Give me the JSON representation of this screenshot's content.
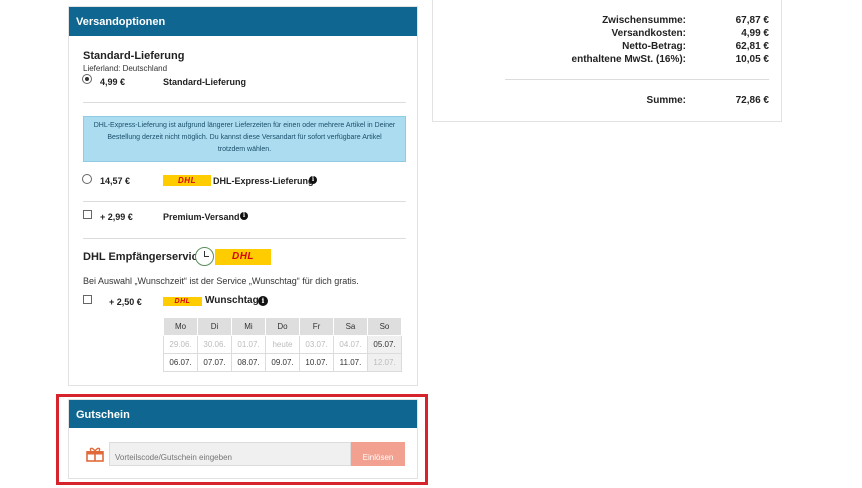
{
  "shipping": {
    "title": "Versandoptionen",
    "standard": {
      "heading": "Standard-Lieferung",
      "country": "Lieferland: Deutschland",
      "price": "4,99 €",
      "label": "Standard-Lieferung",
      "selected": true
    },
    "notice": [
      "DHL-Express-Lieferung ist aufgrund längerer Lieferzeiten für einen oder mehrere Artikel in Deiner",
      "Bestellung derzeit nicht möglich. Du kannst diese Versandart für sofort verfügbare Artikel",
      "trotzdem wählen."
    ],
    "express": {
      "price": "14,57 €",
      "logo": "DHL",
      "label": "DHL-Express-Lieferung"
    },
    "premium": {
      "price": "+ 2,99 €",
      "label": "Premium-Versand"
    },
    "services": {
      "heading": "DHL Empfängerservices",
      "logo": "DHL",
      "note": "Bei Auswahl „Wunschzeit“ ist der Service „Wunschtag“ für dich gratis.",
      "wunschtag": {
        "price": "+ 2,50 €",
        "logo": "DHL",
        "label": "Wunschtag"
      }
    },
    "calendar": {
      "days": [
        "Mo",
        "Di",
        "Mi",
        "Do",
        "Fr",
        "Sa",
        "So"
      ],
      "rows": [
        [
          "29.06.",
          "30.06.",
          "01.07.",
          "heute",
          "03.07.",
          "04.07.",
          "05.07."
        ],
        [
          "06.07.",
          "07.07.",
          "08.07.",
          "09.07.",
          "10.07.",
          "11.07.",
          "12.07."
        ]
      ]
    },
    "icons": {
      "info": "info-icon",
      "clock": "clock-icon",
      "radio": "radio-button",
      "checkbox": "checkbox"
    }
  },
  "voucher": {
    "title": "Gutschein",
    "placeholder": "Vorteilscode/Gutschein eingeben",
    "button": "Einlösen",
    "icon": "gift-icon"
  },
  "summary": {
    "rows": [
      {
        "label": "Zwischensumme:",
        "value": "67,87 €"
      },
      {
        "label": "Versandkosten:",
        "value": "4,99 €"
      },
      {
        "label": "Netto-Betrag:",
        "value": "62,81 €"
      },
      {
        "label": "enthaltene MwSt. (16%):",
        "value": "10,05 €"
      }
    ],
    "total": {
      "label": "Summe:",
      "value": "72,86 €"
    }
  },
  "colors": {
    "header": "#0f6690",
    "notice_bg": "#acdcef",
    "dhl_yellow": "#ffcc00",
    "dhl_red": "#d40511",
    "button": "#f2a08f",
    "highlight": "#d7232c"
  }
}
